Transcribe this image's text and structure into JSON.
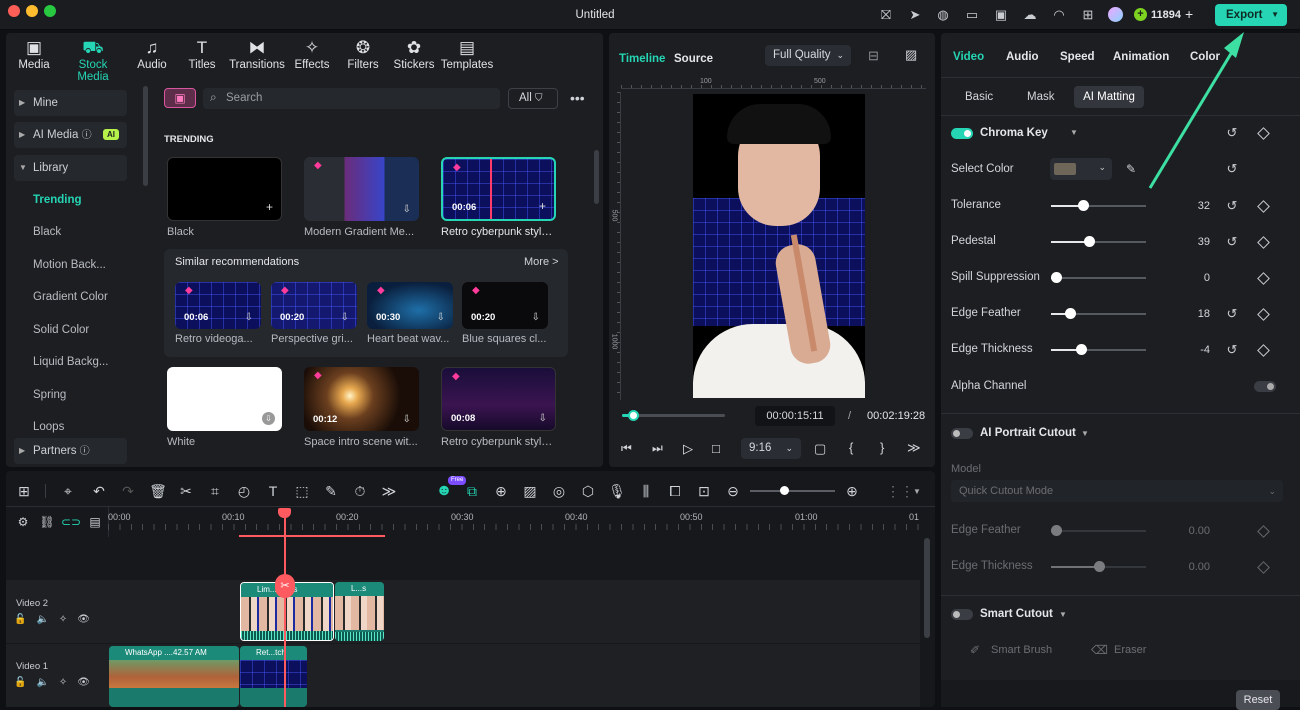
{
  "window": {
    "title": "Untitled",
    "credits": "11894",
    "export_label": "Export"
  },
  "top_nav": [
    {
      "label": "Media",
      "icon": "media-icon"
    },
    {
      "label": "Stock Media",
      "icon": "stock-media-icon"
    },
    {
      "label": "Audio",
      "icon": "audio-icon"
    },
    {
      "label": "Titles",
      "icon": "titles-icon"
    },
    {
      "label": "Transitions",
      "icon": "transitions-icon"
    },
    {
      "label": "Effects",
      "icon": "effects-icon"
    },
    {
      "label": "Filters",
      "icon": "filters-icon"
    },
    {
      "label": "Stickers",
      "icon": "stickers-icon"
    },
    {
      "label": "Templates",
      "icon": "templates-icon"
    }
  ],
  "sidebar": {
    "mine": "Mine",
    "ai_media": "AI Media",
    "ai_badge": "AI",
    "library": "Library",
    "items": [
      "Trending",
      "Black",
      "Motion Back...",
      "Gradient Color",
      "Solid Color",
      "Liquid Backg...",
      "Spring",
      "Loops"
    ],
    "partners": "Partners"
  },
  "search": {
    "placeholder": "Search",
    "filter_label": "All"
  },
  "trending": {
    "heading": "TRENDING",
    "row1": [
      {
        "caption": "Black",
        "duration": ""
      },
      {
        "caption": "Modern Gradient Me...",
        "duration": ""
      },
      {
        "caption": "Retro cyberpunk style...",
        "duration": "00:06"
      }
    ],
    "similar_title": "Similar recommendations",
    "more_label": "More >",
    "similar": [
      {
        "caption": "Retro videoga...",
        "duration": "00:06"
      },
      {
        "caption": "Perspective gri...",
        "duration": "00:20"
      },
      {
        "caption": "Heart beat wav...",
        "duration": "00:30"
      },
      {
        "caption": "Blue squares cl...",
        "duration": "00:20"
      }
    ],
    "row2": [
      {
        "caption": "White",
        "duration": ""
      },
      {
        "caption": "Space intro scene wit...",
        "duration": "00:12"
      },
      {
        "caption": "Retro cyberpunk style...",
        "duration": "00:08"
      }
    ]
  },
  "preview": {
    "tab_timeline": "Timeline",
    "tab_source": "Source",
    "quality": "Full Quality",
    "ruler_top": [
      "100",
      "500"
    ],
    "ruler_left": [
      "500",
      "1000"
    ],
    "current_time": "00:00:15:11",
    "separator": "/",
    "total_time": "00:02:19:28",
    "aspect": "9:16",
    "progress": 0.11
  },
  "properties": {
    "tabs": [
      "Video",
      "Audio",
      "Speed",
      "Animation",
      "Color"
    ],
    "subtabs": [
      "Basic",
      "Mask",
      "AI Matting"
    ],
    "chroma_key": "Chroma Key",
    "select_color": "Select Color",
    "sliders": [
      {
        "label": "Tolerance",
        "value": "32",
        "level": 0.34
      },
      {
        "label": "Pedestal",
        "value": "39",
        "level": 0.4
      },
      {
        "label": "Spill Suppression",
        "value": "0",
        "level": 0.05
      },
      {
        "label": "Edge Feather",
        "value": "18",
        "level": 0.2
      },
      {
        "label": "Edge Thickness",
        "value": "-4",
        "level": 0.32
      }
    ],
    "alpha_channel": "Alpha Channel",
    "ai_portrait": "AI Portrait Cutout",
    "model_label": "Model",
    "model_value": "Quick Cutout Mode",
    "ai_sliders": [
      {
        "label": "Edge Feather",
        "value": "0.00",
        "level": 0.05
      },
      {
        "label": "Edge Thickness",
        "value": "0.00",
        "level": 0.5
      }
    ],
    "smart_cutout": "Smart Cutout",
    "smart_brush": "Smart Brush",
    "eraser": "Eraser",
    "reset": "Reset"
  },
  "timeline": {
    "ai_badge": "Free",
    "ruler": [
      "00:00",
      "00:10",
      "00:20",
      "00:30",
      "00:40",
      "00:50",
      "01:00",
      "01"
    ],
    "tracks": [
      {
        "label": "Video 2",
        "clips": [
          "Lim...hacks",
          "L...s"
        ]
      },
      {
        "label": "Video 1",
        "clips": [
          "WhatsApp ....42.57 AM",
          "Ret...tch"
        ]
      }
    ]
  },
  "colors": {
    "accent": "#25d5b4",
    "playhead": "#ff5a5f",
    "gem": "#ff3b9b"
  }
}
